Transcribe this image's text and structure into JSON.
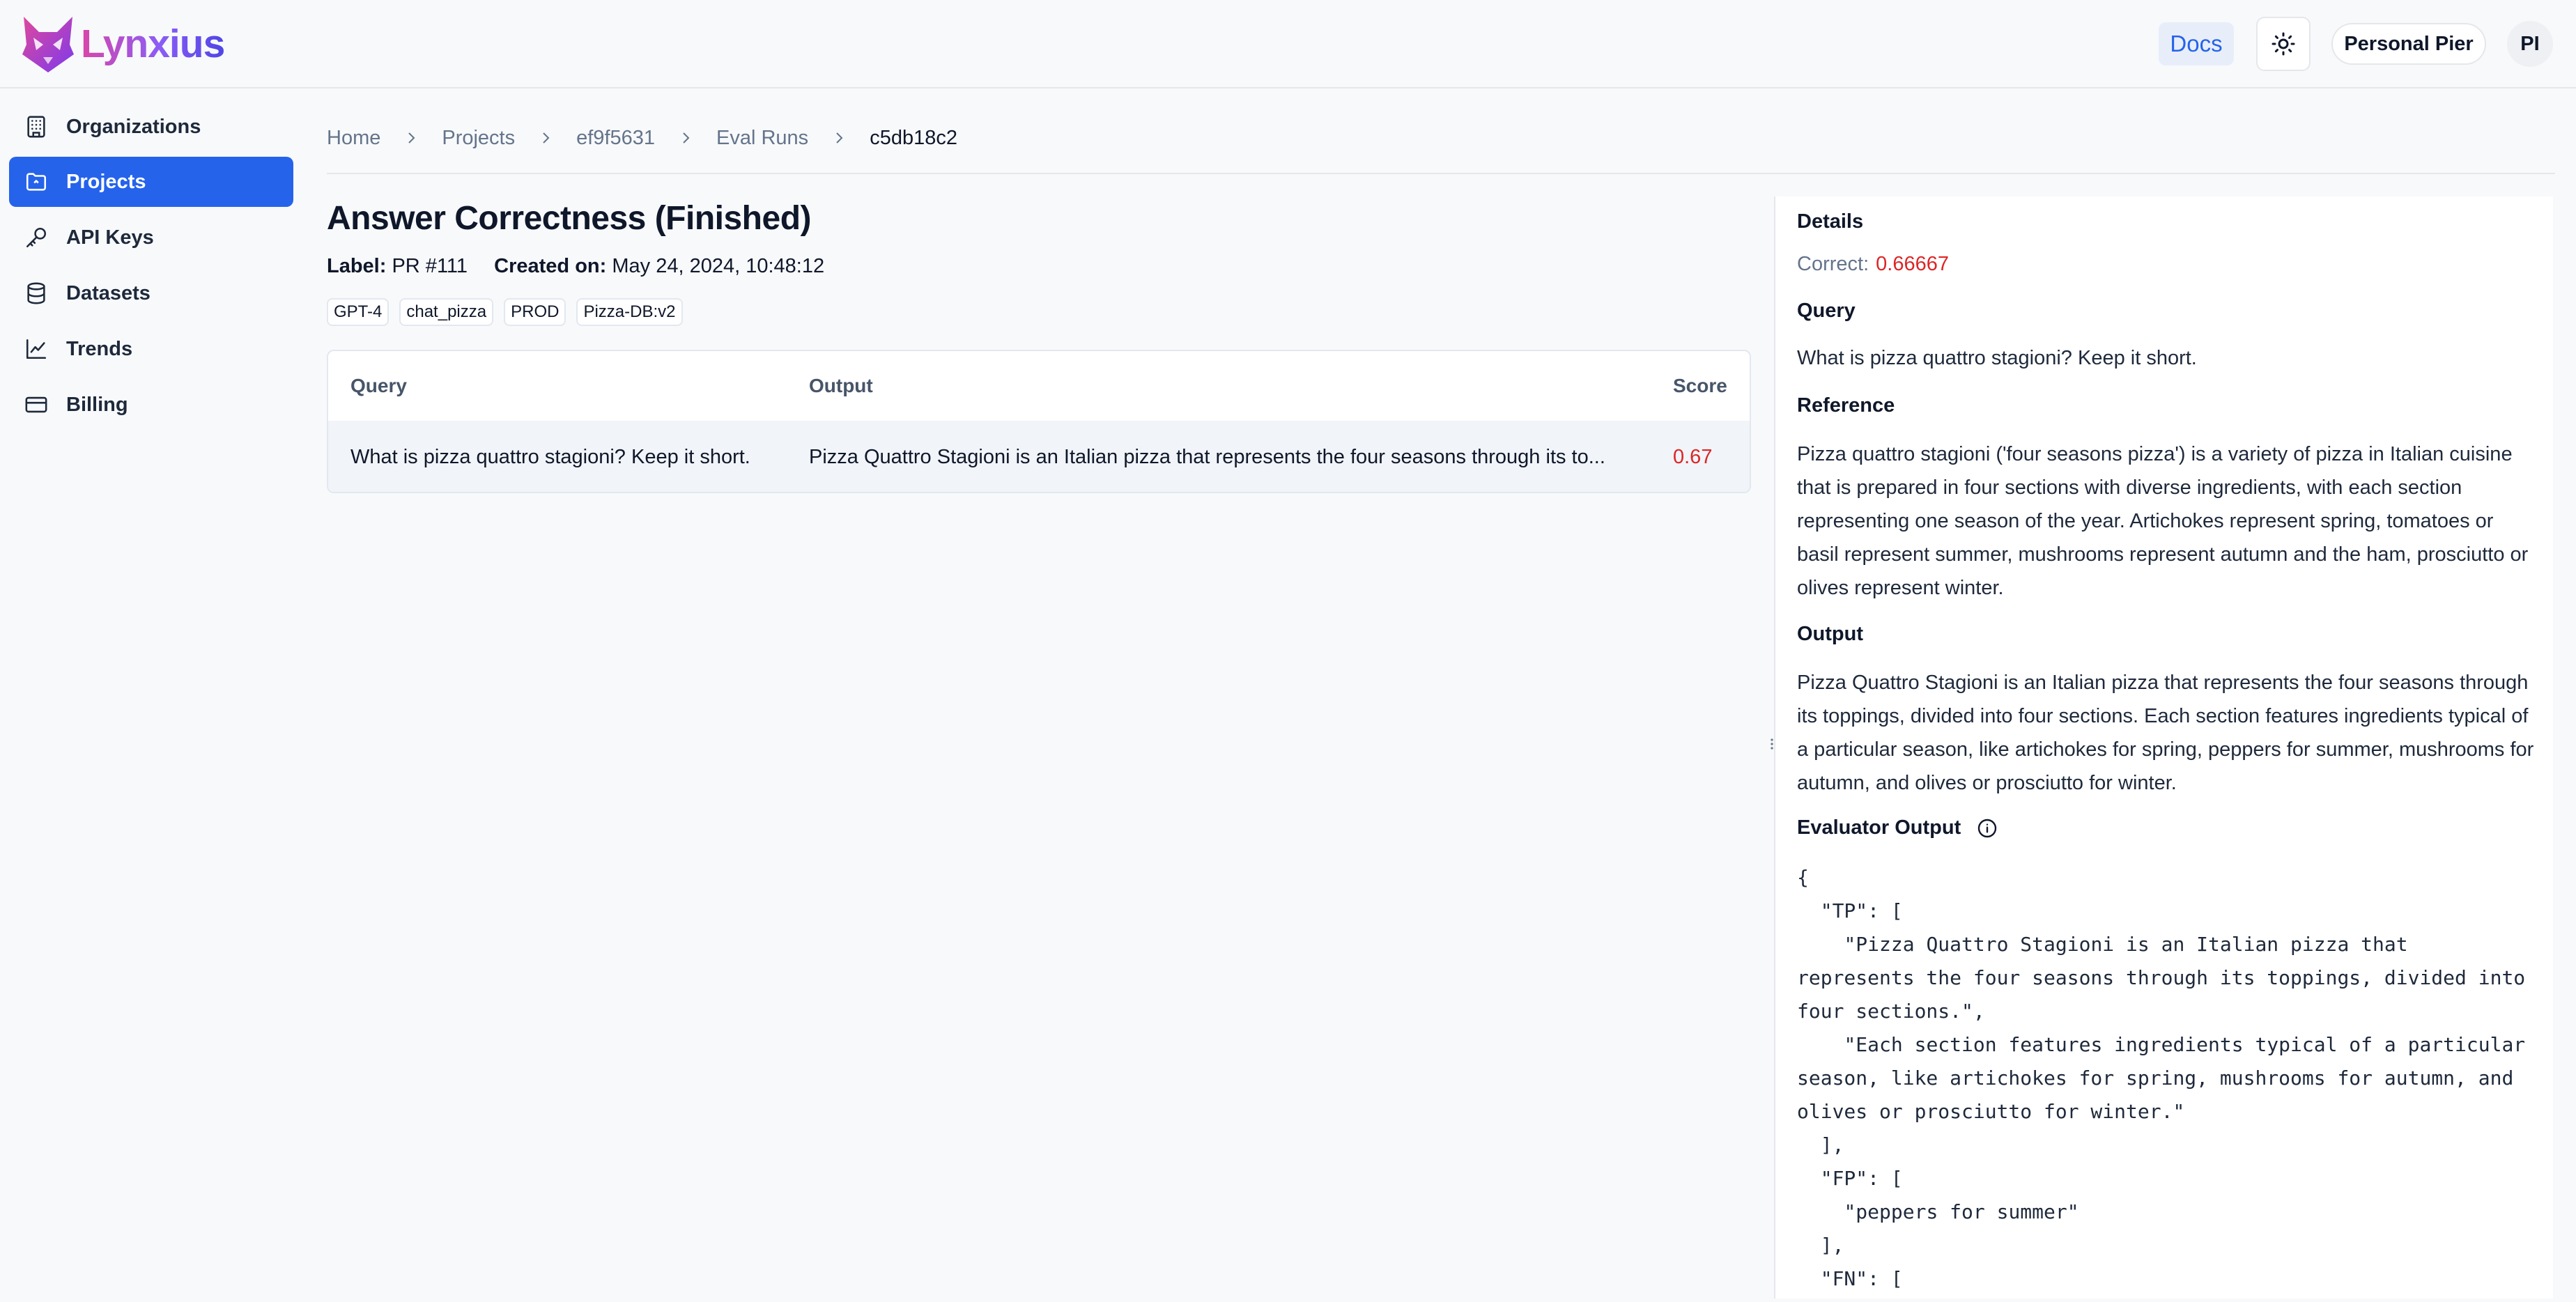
{
  "header": {
    "brand": "Lynxius",
    "docs_label": "Docs",
    "user_name": "Personal Pier",
    "avatar_initials": "PI",
    "accent_color": "#2563eb"
  },
  "sidebar": {
    "items": [
      {
        "label": "Organizations",
        "icon": "building-icon",
        "active": false
      },
      {
        "label": "Projects",
        "icon": "folder-icon",
        "active": true
      },
      {
        "label": "API Keys",
        "icon": "key-icon",
        "active": false
      },
      {
        "label": "Datasets",
        "icon": "database-icon",
        "active": false
      },
      {
        "label": "Trends",
        "icon": "trend-chart-icon",
        "active": false
      },
      {
        "label": "Billing",
        "icon": "credit-card-icon",
        "active": false
      }
    ]
  },
  "breadcrumb": [
    "Home",
    "Projects",
    "ef9f5631",
    "Eval Runs",
    "c5db18c2"
  ],
  "run": {
    "title": "Answer Correctness (Finished)",
    "label_key": "Label:",
    "label_value": "PR #111",
    "created_key": "Created on:",
    "created_value": "May 24, 2024, 10:48:12",
    "tags": [
      "GPT-4",
      "chat_pizza",
      "PROD",
      "Pizza-DB:v2"
    ]
  },
  "table": {
    "columns": [
      "Query",
      "Output",
      "Score"
    ],
    "rows": [
      {
        "query": "What is pizza quattro stagioni? Keep it short.",
        "output": "Pizza Quattro Stagioni is an Italian pizza that represents the four seasons through its to...",
        "score": "0.67"
      }
    ]
  },
  "details": {
    "title": "Details",
    "correct_label": "Correct:",
    "correct_value": "0.66667",
    "query_label": "Query",
    "query_text": "What is pizza quattro stagioni? Keep it short.",
    "reference_label": "Reference",
    "reference_text": "Pizza quattro stagioni ('four seasons pizza') is a variety of pizza in Italian cuisine that is prepared in four sections with diverse ingredients, with each section representing one season of the year. Artichokes represent spring, tomatoes or basil represent summer, mushrooms represent autumn and the ham, prosciutto or olives represent winter.",
    "output_label": "Output",
    "output_text": "Pizza Quattro Stagioni is an Italian pizza that represents the four seasons through its toppings, divided into four sections. Each section features ingredients typical of a particular season, like artichokes for spring, peppers for summer, mushrooms for autumn, and olives or prosciutto for winter.",
    "evaluator_label": "Evaluator Output",
    "evaluator_json": "{\n  \"TP\": [\n    \"Pizza Quattro Stagioni is an Italian pizza that represents the four seasons through its toppings, divided into four sections.\",\n    \"Each section features ingredients typical of a particular season, like artichokes for spring, mushrooms for autumn, and olives or prosciutto for winter.\"\n  ],\n  \"FP\": [\n    \"peppers for summer\"\n  ],\n  \"FN\": ["
  }
}
